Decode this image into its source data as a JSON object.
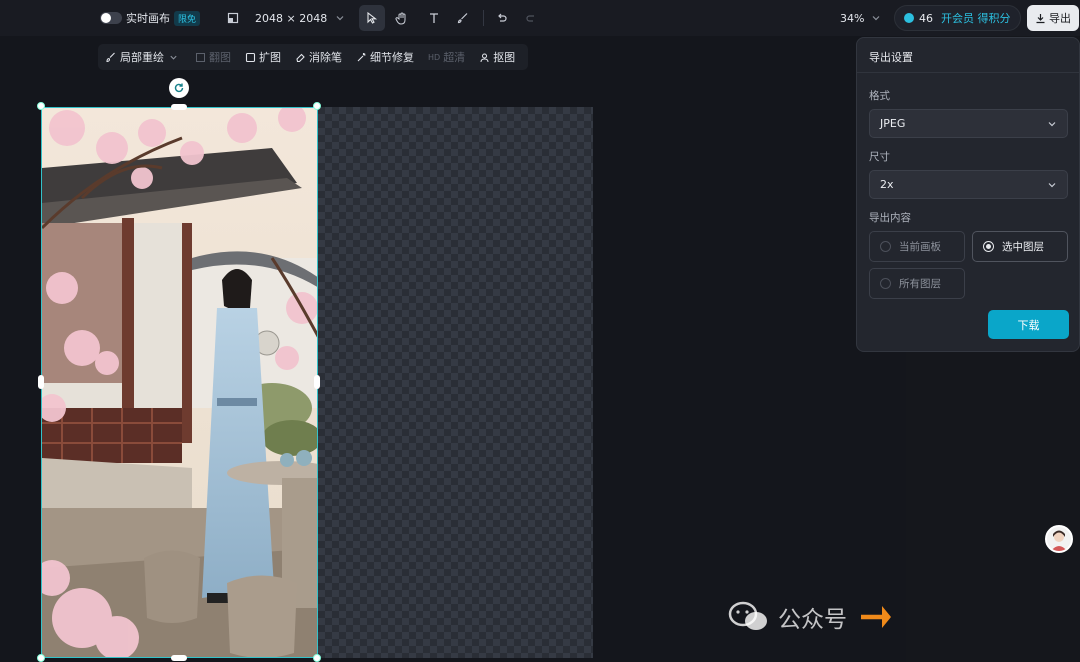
{
  "topbar": {
    "realtime_label": "实时画布",
    "realtime_badge": "限免",
    "canvas_size": "2048 × 2048",
    "zoom": "34%",
    "credits": "46",
    "membership": "开会员 得积分",
    "export_label": "导出"
  },
  "subtoolbar": {
    "items": [
      {
        "label": "局部重绘",
        "enabled": true
      },
      {
        "label": "扩图",
        "enabled": true
      },
      {
        "label": "消除笔",
        "enabled": true
      },
      {
        "label": "细节修复",
        "enabled": true
      },
      {
        "label": "超清",
        "enabled": false
      },
      {
        "label": "抠图",
        "enabled": true
      }
    ],
    "disabled_first": "翻图"
  },
  "export_panel": {
    "title": "导出设置",
    "format_label": "格式",
    "format_value": "JPEG",
    "size_label": "尺寸",
    "size_value": "2x",
    "content_label": "导出内容",
    "options": [
      {
        "label": "当前画板",
        "selected": false
      },
      {
        "label": "选中图层",
        "selected": true
      },
      {
        "label": "所有图层",
        "selected": false
      }
    ],
    "download_label": "下载"
  },
  "watermark": {
    "text": "公众号"
  },
  "colors": {
    "accent": "#0aa6c9",
    "selection": "#33c2c9"
  }
}
